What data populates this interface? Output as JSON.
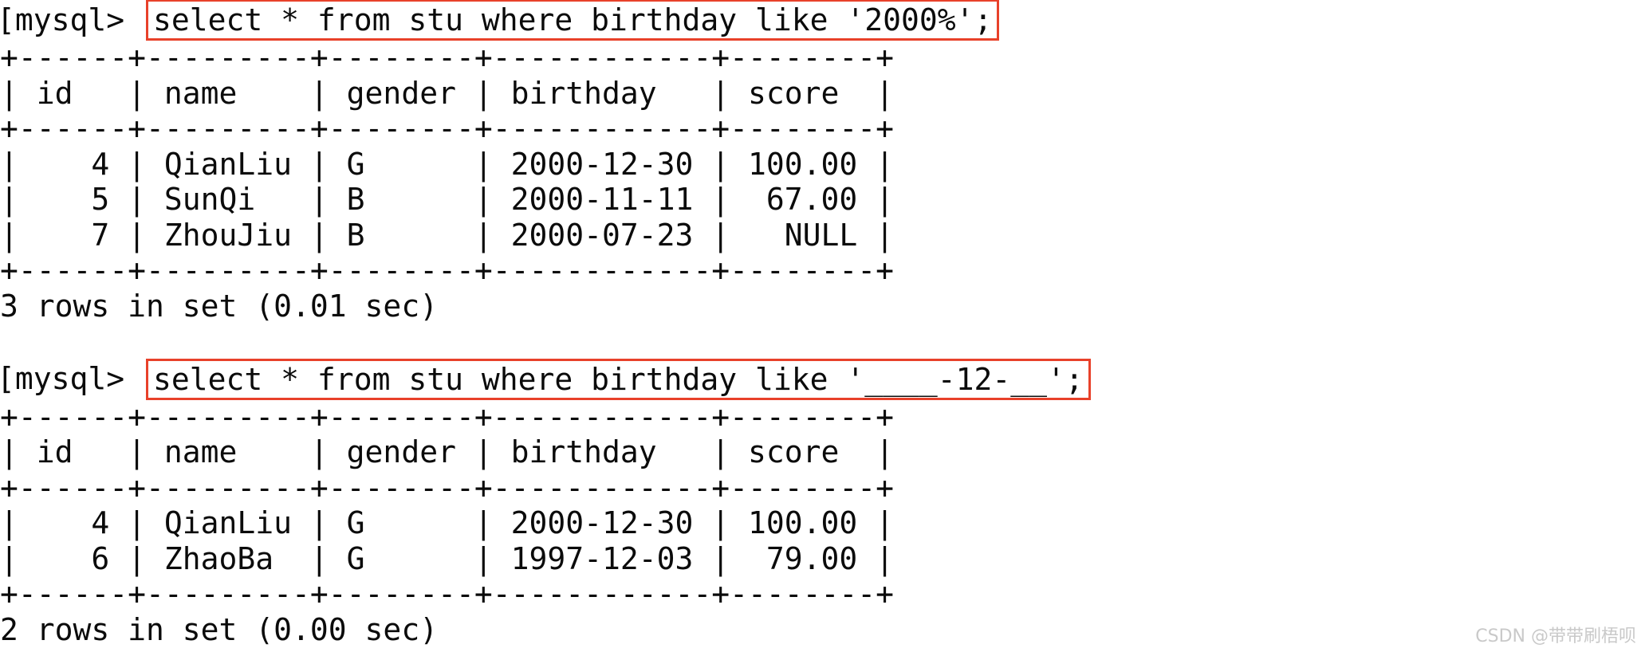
{
  "terminal": {
    "background_color": "#ffffff",
    "text_color": "#0b0b0b",
    "highlight_border_color": "#e8412a",
    "prompt": "[mysql> ",
    "blocks": [
      {
        "command": "select * from stu where birthday like '2000%';",
        "table": {
          "separator": "+------+---------+--------+------------+--------+",
          "header": "| id   | name    | gender | birthday   | score  |",
          "columns": [
            "id",
            "name",
            "gender",
            "birthday",
            "score"
          ],
          "rows": [
            "|    4 | QianLiu | G      | 2000-12-30 | 100.00 |",
            "|    5 | SunQi   | B      | 2000-11-11 |  67.00 |",
            "|    7 | ZhouJiu | B      | 2000-07-23 |   NULL |"
          ],
          "row_values": [
            {
              "id": "4",
              "name": "QianLiu",
              "gender": "G",
              "birthday": "2000-12-30",
              "score": "100.00"
            },
            {
              "id": "5",
              "name": "SunQi",
              "gender": "B",
              "birthday": "2000-11-11",
              "score": "67.00"
            },
            {
              "id": "7",
              "name": "ZhouJiu",
              "gender": "B",
              "birthday": "2000-07-23",
              "score": "NULL"
            }
          ]
        },
        "status": "3 rows in set (0.01 sec)"
      },
      {
        "command": "select * from stu where birthday like '____-12-__';",
        "table": {
          "separator": "+------+---------+--------+------------+--------+",
          "header": "| id   | name    | gender | birthday   | score  |",
          "columns": [
            "id",
            "name",
            "gender",
            "birthday",
            "score"
          ],
          "rows": [
            "|    4 | QianLiu | G      | 2000-12-30 | 100.00 |",
            "|    6 | ZhaoBa  | G      | 1997-12-03 |  79.00 |"
          ],
          "row_values": [
            {
              "id": "4",
              "name": "QianLiu",
              "gender": "G",
              "birthday": "2000-12-30",
              "score": "100.00"
            },
            {
              "id": "6",
              "name": "ZhaoBa",
              "gender": "G",
              "birthday": "1997-12-03",
              "score": "79.00"
            }
          ]
        },
        "status": "2 rows in set (0.00 sec)"
      }
    ]
  },
  "watermark": {
    "text": "CSDN @带带刷梧呗"
  }
}
